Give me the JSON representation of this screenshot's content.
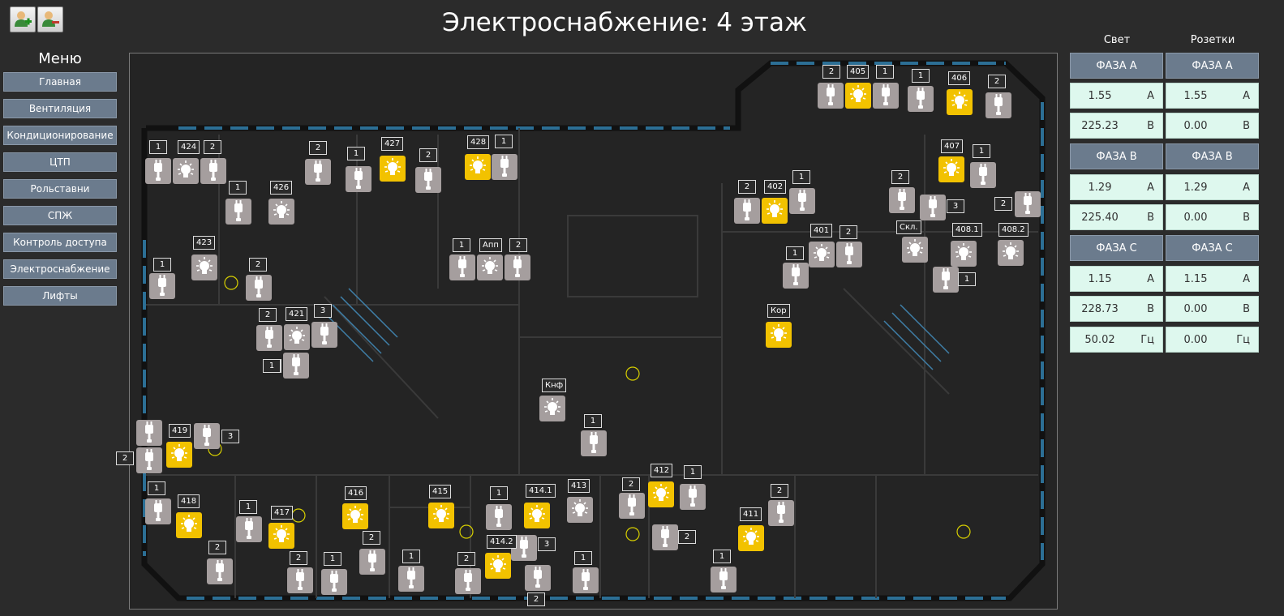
{
  "title": "Электроснабжение: 4 этаж",
  "menu": {
    "title": "Меню",
    "items": [
      "Главная",
      "Вентиляция",
      "Кондиционирование",
      "ЦТП",
      "Рольставни",
      "СПЖ",
      "Контроль доступа",
      "Электроснабжение",
      "Лифты"
    ]
  },
  "panel": {
    "col_light": "Свет",
    "col_sockets": "Розетки",
    "light": {
      "phase_a": "ФАЗА A",
      "a_current": "1.55",
      "a_voltage": "225.23",
      "phase_b": "ФАЗА B",
      "b_current": "1.29",
      "b_voltage": "225.40",
      "phase_c": "ФАЗА C",
      "c_current": "1.15",
      "c_voltage": "228.73",
      "freq": "50.02"
    },
    "sockets": {
      "phase_a": "ФАЗА A",
      "a_current": "1.55",
      "a_voltage": "0.00",
      "phase_b": "ФАЗА B",
      "b_current": "1.29",
      "b_voltage": "0.00",
      "phase_c": "ФАЗА C",
      "c_current": "1.15",
      "c_voltage": "0.00",
      "freq": "0.00"
    },
    "units": {
      "amp": "А",
      "volt": "В",
      "hz": "Гц"
    }
  },
  "plan": {
    "labels": [
      "1",
      "424",
      "2",
      "2",
      "1",
      "427",
      "2",
      "428",
      "1",
      "1",
      "426",
      "423",
      "1",
      "2",
      "2",
      "421",
      "3",
      "1",
      "Апп",
      "1",
      "2",
      "2",
      "405",
      "1",
      "1",
      "406",
      "2",
      "2",
      "402",
      "1",
      "407",
      "1",
      "2",
      "3",
      "2",
      "401",
      "2",
      "1",
      "Скл.",
      "408.1",
      "408.2",
      "1",
      "Кор",
      "Кнф",
      "1",
      "1",
      "419",
      "3",
      "2",
      "1",
      "418",
      "1",
      "417",
      "2",
      "2",
      "1",
      "416",
      "2",
      "415",
      "1",
      "2",
      "1",
      "414.1",
      "414.2",
      "3",
      "2",
      "413",
      "1",
      "2",
      "412",
      "1",
      "2",
      "411",
      "2",
      "1"
    ]
  },
  "colors": {
    "background": "#2b2b2b",
    "menu_button": "#6b7b8d",
    "device_off": "#a59e9e",
    "device_on": "#f2c200",
    "value_box": "#def8ee",
    "wall_blue": "#2c6f95"
  }
}
